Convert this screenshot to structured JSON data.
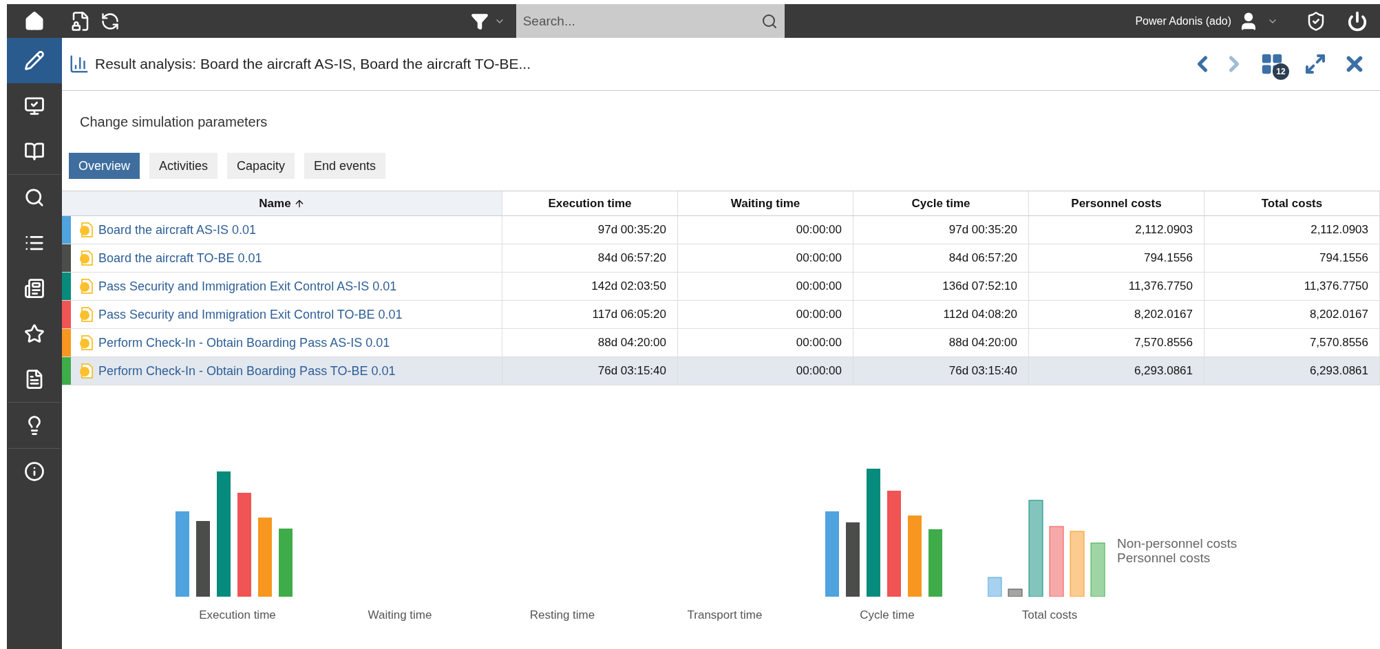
{
  "top_bar": {
    "search": {
      "placeholder": "Search..."
    },
    "user": "Power Adonis (ado)"
  },
  "sidebar": {
    "items": [
      {
        "kind": "edit",
        "selected": true
      },
      {
        "kind": "monitor",
        "selected": false
      },
      {
        "kind": "book",
        "selected": false
      },
      {
        "kind": "search",
        "selected": false
      },
      {
        "kind": "list",
        "selected": false
      },
      {
        "kind": "card",
        "selected": false
      },
      {
        "kind": "star",
        "selected": false
      },
      {
        "kind": "document",
        "selected": false
      },
      {
        "kind": "bulb",
        "selected": false
      },
      {
        "kind": "info",
        "selected": false
      }
    ]
  },
  "header": {
    "title": "Result analysis: Board the aircraft AS-IS, Board the aircraft TO-BE...",
    "window_count": "12"
  },
  "link": "Change simulation parameters",
  "tabs": [
    {
      "label": "Overview",
      "selected": true
    },
    {
      "label": "Activities",
      "selected": false
    },
    {
      "label": "Capacity",
      "selected": false
    },
    {
      "label": "End events",
      "selected": false
    }
  ],
  "table": {
    "columns": [
      "Name",
      "Execution time",
      "Waiting time",
      "Cycle time",
      "Personnel costs",
      "Total costs"
    ],
    "rows": [
      {
        "color": "#4fa3de",
        "selected": false,
        "cells": [
          "Board the aircraft AS-IS 0.01",
          "97d 00:35:20",
          "00:00:00",
          "97d 00:35:20",
          "2,112.0903",
          "2,112.0903"
        ]
      },
      {
        "color": "#4b4d4a",
        "selected": false,
        "cells": [
          "Board the aircraft TO-BE 0.01",
          "84d 06:57:20",
          "00:00:00",
          "84d 06:57:20",
          "794.1556",
          "794.1556"
        ]
      },
      {
        "color": "#078b7c",
        "selected": false,
        "cells": [
          "Pass Security and Immigration Exit Control AS-IS 0.01",
          "142d 02:03:50",
          "00:00:00",
          "136d 07:52:10",
          "11,376.7750",
          "11,376.7750"
        ]
      },
      {
        "color": "#f05454",
        "selected": false,
        "cells": [
          "Pass Security and Immigration Exit Control TO-BE 0.01",
          "117d 06:05:20",
          "00:00:00",
          "112d 04:08:20",
          "8,202.0167",
          "8,202.0167"
        ]
      },
      {
        "color": "#f7971f",
        "selected": false,
        "cells": [
          "Perform Check-In - Obtain Boarding Pass AS-IS 0.01",
          "88d 04:20:00",
          "00:00:00",
          "88d 04:20:00",
          "7,570.8556",
          "7,570.8556"
        ]
      },
      {
        "color": "#3fac4a",
        "selected": true,
        "cells": [
          "Perform Check-In - Obtain Boarding Pass TO-BE 0.01",
          "76d 03:15:40",
          "00:00:00",
          "76d 03:15:40",
          "6,293.0861",
          "6,293.0861"
        ]
      }
    ]
  },
  "charts": {
    "groups": [
      {
        "label": "Execution time",
        "kind": "solid"
      },
      {
        "label": "Waiting time",
        "kind": "empty"
      },
      {
        "label": "Resting time",
        "kind": "empty"
      },
      {
        "label": "Transport time",
        "kind": "empty"
      },
      {
        "label": "Cycle time",
        "kind": "solid"
      },
      {
        "label": "Total costs",
        "kind": "faded"
      }
    ],
    "legend": [
      "Non-personnel costs",
      "Personnel costs"
    ]
  }
}
